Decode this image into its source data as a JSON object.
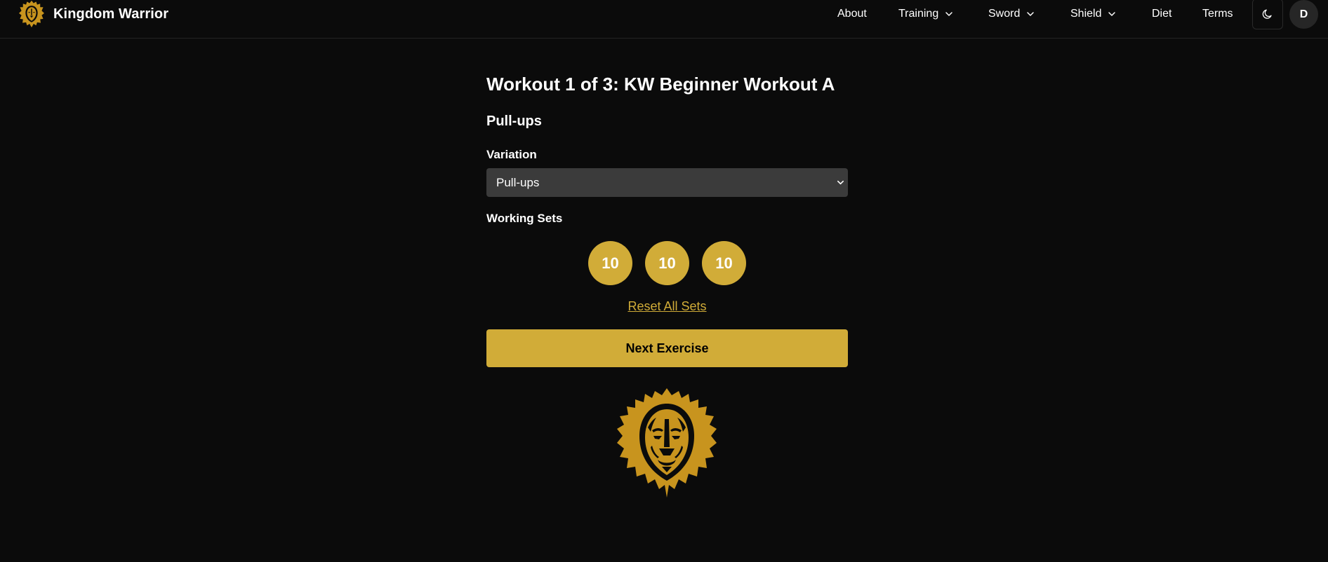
{
  "brand": {
    "name": "Kingdom Warrior",
    "logo_icon": "lion-head-icon",
    "accent_color": "#d1ac38"
  },
  "nav": {
    "items": [
      {
        "label": "About",
        "has_dropdown": false
      },
      {
        "label": "Training",
        "has_dropdown": true
      },
      {
        "label": "Sword",
        "has_dropdown": true
      },
      {
        "label": "Shield",
        "has_dropdown": true
      },
      {
        "label": "Diet",
        "has_dropdown": false
      },
      {
        "label": "Terms",
        "has_dropdown": false
      }
    ],
    "theme_toggle_icon": "moon-icon",
    "avatar_initial": "D"
  },
  "workout": {
    "title": "Workout 1 of 3: KW Beginner Workout A",
    "exercise": "Pull-ups",
    "variation_label": "Variation",
    "variation_selected": "Pull-ups",
    "working_sets_label": "Working Sets",
    "sets": [
      "10",
      "10",
      "10"
    ],
    "reset_label": "Reset All Sets",
    "next_label": "Next Exercise"
  }
}
